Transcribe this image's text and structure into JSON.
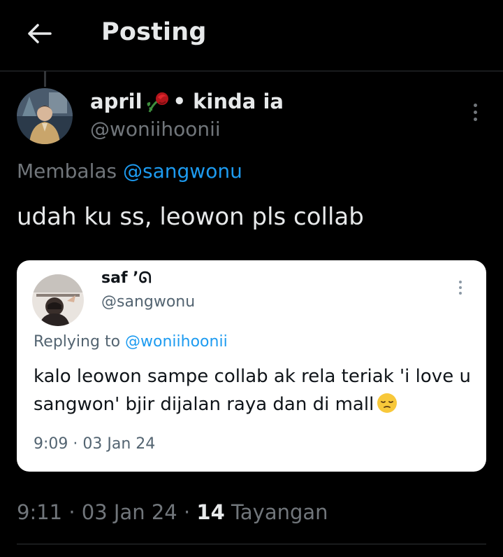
{
  "header": {
    "title": "Posting",
    "back_icon": "arrow-left-icon"
  },
  "tweet": {
    "display_name_prefix": "april",
    "display_name_emoji": "wilted-rose-emoji",
    "display_name_suffix": "• kinda ia",
    "handle": "@woniihoonii",
    "replying_prefix": "Membalas",
    "replying_mention": "@sangwonu",
    "text": "udah ku ss, leowon pls collab",
    "time": "9:11 · 03 Jan 24 ·",
    "view_count": "14",
    "view_label": "Tayangan"
  },
  "quoted": {
    "display_name": "saf ’ᘏ",
    "handle": "@sangwonu",
    "replying_prefix": "Replying to",
    "replying_mention": "@woniihoonii",
    "text": "kalo leowon sampe collab ak rela teriak 'i love u sangwon' bjir dijalan raya dan di mall",
    "emoji": "pensive-face-emoji",
    "time": "9:09 · 03 Jan 24"
  },
  "colors": {
    "background": "#000000",
    "text": "#e7e9ea",
    "muted": "#71767b",
    "link": "#1d9bf0",
    "card_bg": "#ffffff"
  }
}
